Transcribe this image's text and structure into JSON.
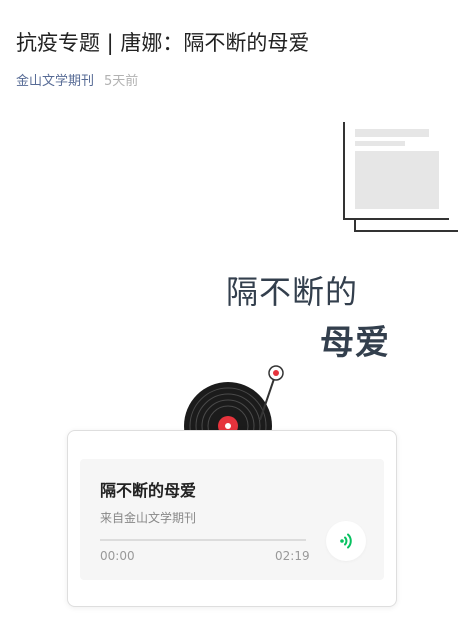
{
  "article": {
    "title": "抗疫专题 | 唐娜：隔不断的母爱",
    "author": "金山文学期刊",
    "time": "5天前"
  },
  "cover": {
    "headline_line1": "隔不断的",
    "headline_line2": "母爱"
  },
  "audio": {
    "title": "隔不断的母爱",
    "source": "来自金山文学期刊",
    "current_time": "00:00",
    "duration": "02:19",
    "progress": 0,
    "accent_color": "#07c160",
    "play_icon": "audio-wave-icon"
  }
}
